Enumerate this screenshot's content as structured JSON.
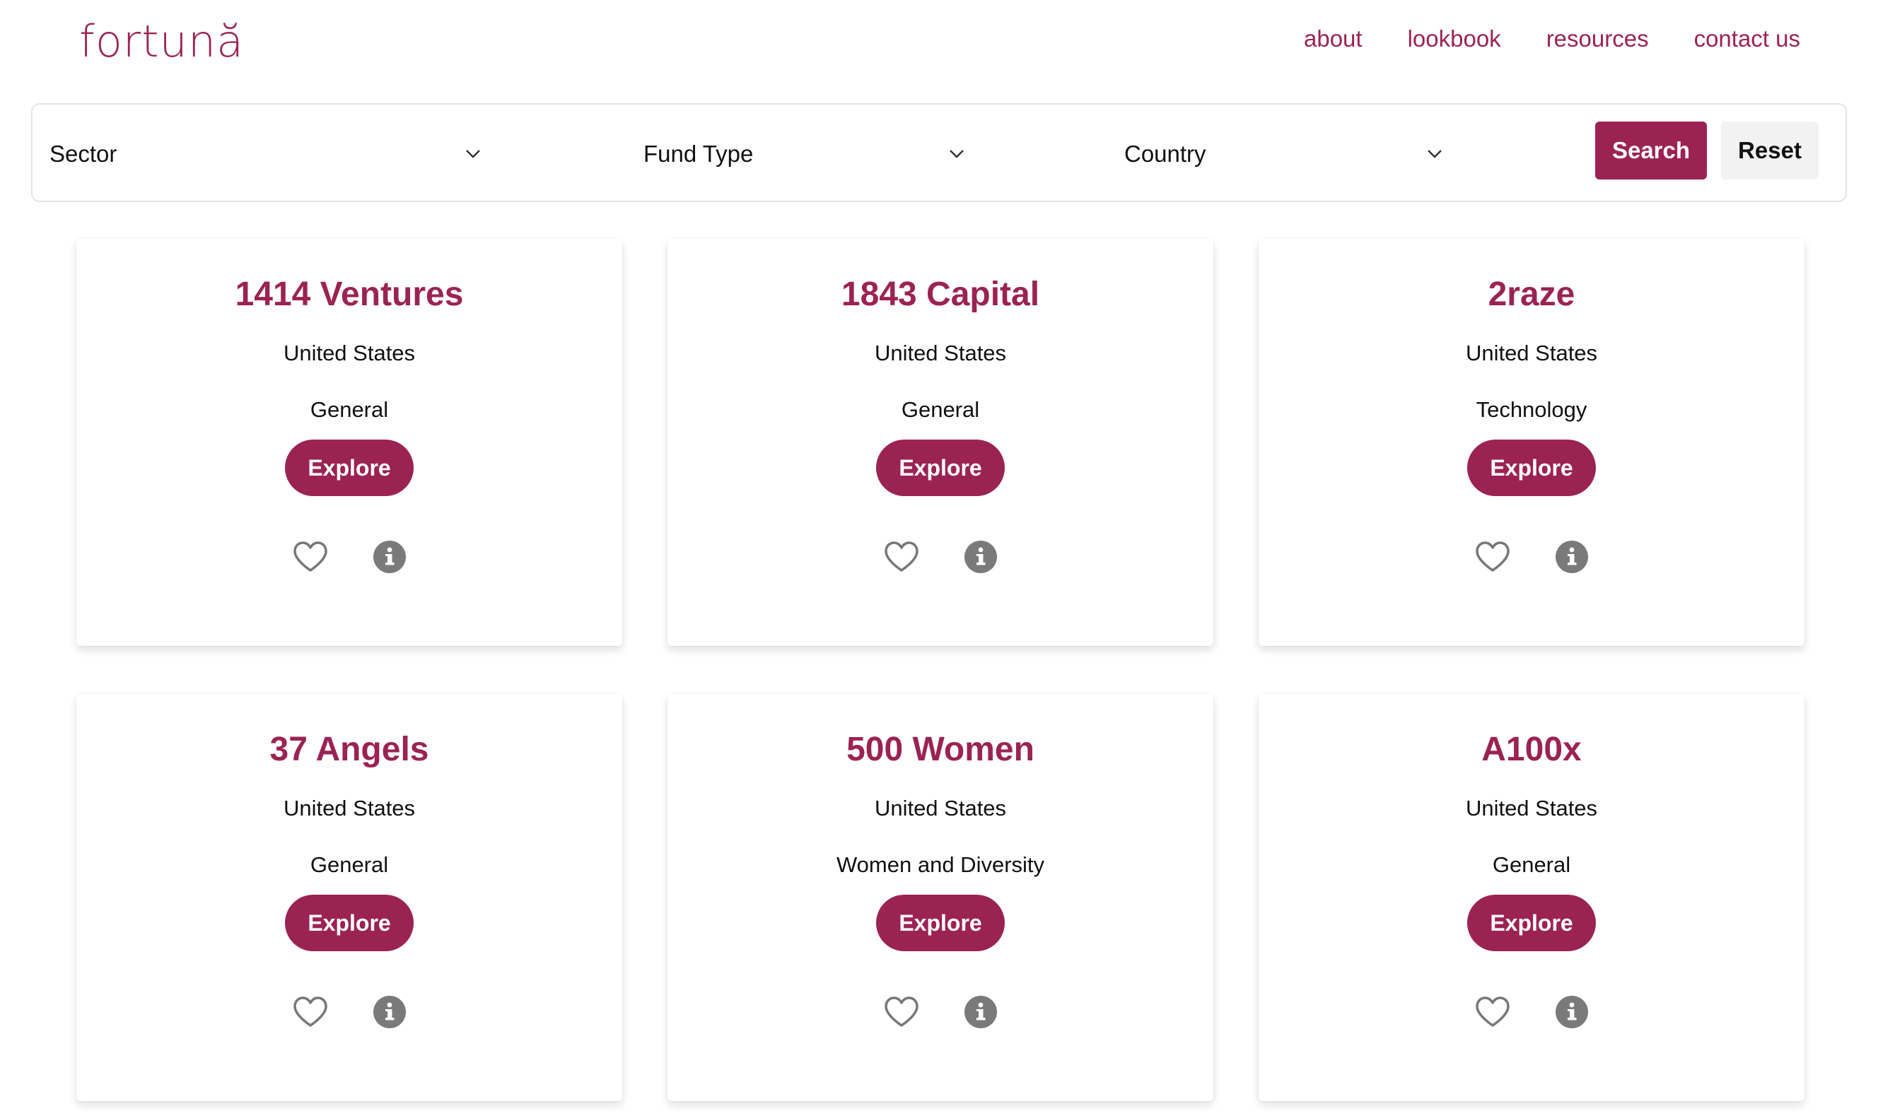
{
  "brand": {
    "logo": "fortună",
    "accent": "#9b2353"
  },
  "nav": [
    "about",
    "lookbook",
    "resources",
    "contact us"
  ],
  "filters": {
    "sector": "Sector",
    "fund_type": "Fund Type",
    "country": "Country",
    "search_label": "Search",
    "reset_label": "Reset"
  },
  "cards": [
    {
      "name": "1414 Ventures",
      "country": "United States",
      "sector": "General",
      "explore": "Explore",
      "icons": [
        "heart-icon",
        "info-icon"
      ]
    },
    {
      "name": "1843 Capital",
      "country": "United States",
      "sector": "General",
      "explore": "Explore",
      "icons": [
        "heart-icon",
        "info-icon"
      ]
    },
    {
      "name": "2raze",
      "country": "United States",
      "sector": "Technology",
      "explore": "Explore",
      "icons": [
        "heart-icon",
        "info-icon"
      ]
    },
    {
      "name": "37 Angels",
      "country": "United States",
      "sector": "General",
      "explore": "Explore",
      "icons": [
        "heart-icon",
        "info-icon"
      ]
    },
    {
      "name": "500 Women",
      "country": "United States",
      "sector": "Women and Diversity",
      "explore": "Explore",
      "icons": [
        "heart-icon",
        "info-icon"
      ]
    },
    {
      "name": "A100x",
      "country": "United States",
      "sector": "General",
      "explore": "Explore",
      "icons": [
        "heart-icon",
        "info-icon"
      ]
    }
  ]
}
